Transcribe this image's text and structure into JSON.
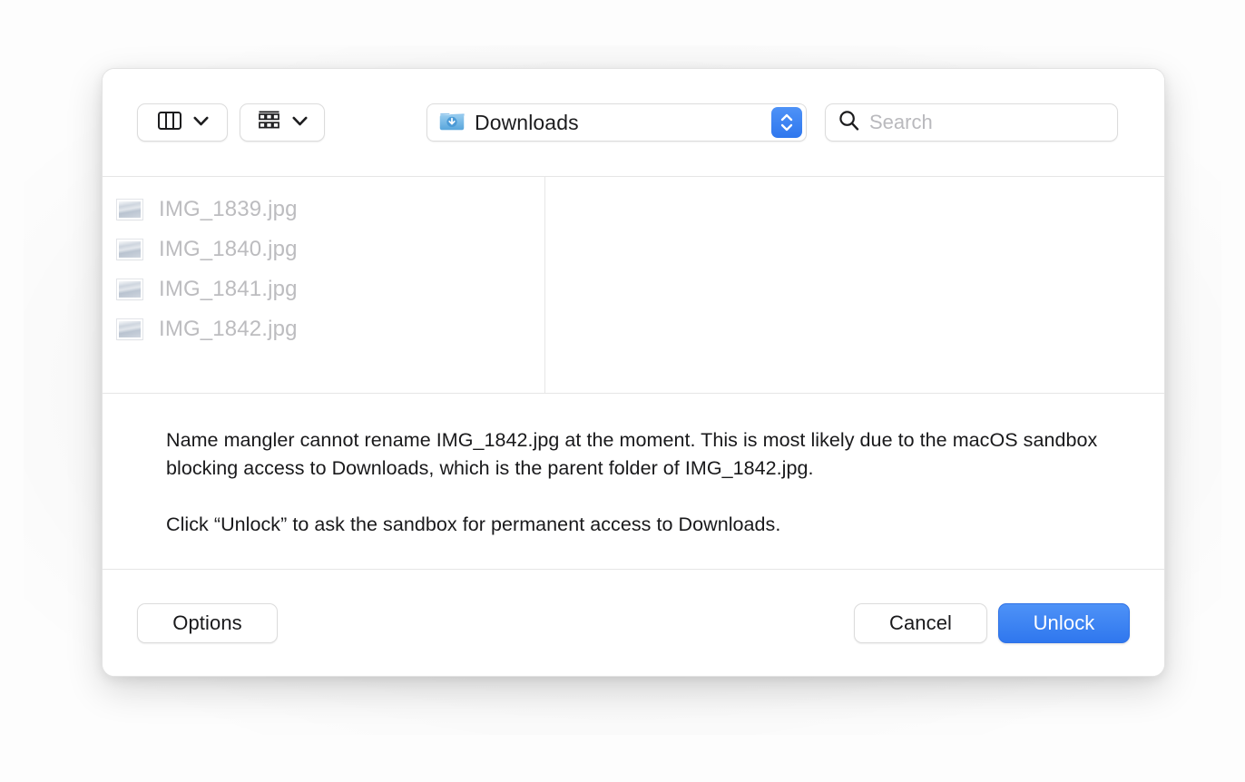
{
  "toolbar": {
    "view_button": {
      "icon": "column-view-icon",
      "chevron": "chevron-down-icon"
    },
    "group_button": {
      "icon": "group-items-icon",
      "chevron": "chevron-down-icon"
    },
    "path_popup": {
      "icon": "downloads-folder-icon",
      "label": "Downloads",
      "stepper": "up-down-stepper-icon"
    },
    "search": {
      "icon": "search-icon",
      "value": "",
      "placeholder": "Search"
    }
  },
  "browser": {
    "files": [
      {
        "name": "IMG_1839.jpg",
        "icon": "image-thumbnail"
      },
      {
        "name": "IMG_1840.jpg",
        "icon": "image-thumbnail"
      },
      {
        "name": "IMG_1841.jpg",
        "icon": "image-thumbnail"
      },
      {
        "name": "IMG_1842.jpg",
        "icon": "image-thumbnail"
      }
    ]
  },
  "message": {
    "paragraph1": "Name mangler cannot rename IMG_1842.jpg at the moment. This is most likely due to the macOS sandbox blocking access to Downloads, which is the parent folder of IMG_1842.jpg.",
    "paragraph2": "Click “Unlock” to ask the sandbox for permanent access to Downloads."
  },
  "buttons": {
    "options": "Options",
    "cancel": "Cancel",
    "unlock": "Unlock"
  },
  "colors": {
    "accent_blue": "#3B7DF0",
    "dialog_background": "#FFFFFF",
    "disabled_text": "#BCBCBF",
    "body_text": "#19191B",
    "divider": "#E6E6E6"
  }
}
